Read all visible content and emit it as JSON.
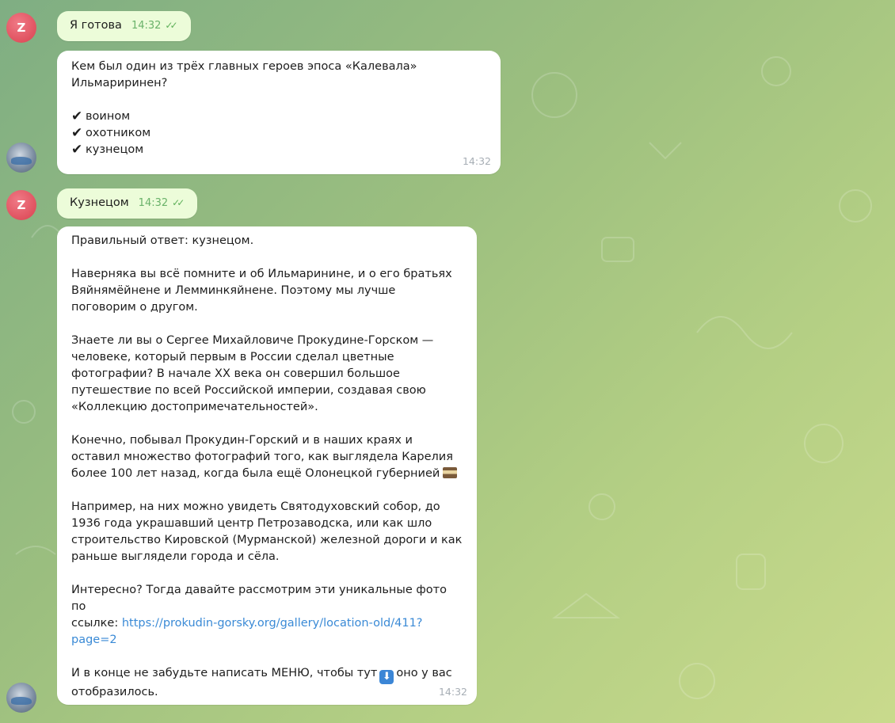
{
  "chat": {
    "user_avatar_initial": "Z",
    "messages": [
      {
        "text": "Я готова",
        "time": "14:32"
      },
      {
        "question": "Кем был один из трёх главных героев эпоса «Калевала»\nИльмариринен?",
        "options": [
          "воином",
          "охотником",
          "кузнецом"
        ],
        "time": "14:32"
      },
      {
        "text": "Кузнецом",
        "time": "14:32"
      },
      {
        "paragraphs": [
          "Правильный ответ: кузнецом.",
          "Наверняка вы всё помните и об Ильмаринине, и о его братьях\nВяйнямёйнене и Лемминкяйнене. Поэтому мы лучше\nпоговорим о другом.",
          "Знаете ли вы о Сергее Михайловиче Прокудине-Горском —\nчеловеке, который первым в России сделал цветные\nфотографии? В начале XX века он совершил большое\nпутешествие по всей Российской империи, создавая свою\n«Коллекцию достопримечательностей».",
          "Конечно, побывал Прокудин-Горский и в наших краях и\nоставил множество фотографий того, как выглядела Карелия\nболее 100 лет назад, когда была ещё Олонецкой губернией",
          "Например, на них можно увидеть Святодуховский собор, до\n1936 года украшавший центр Петрозаводска, или как шло\nстроительство Кировской (Мурманской) железной дороги и как\nраньше выглядели города и сёла.",
          "Интересно? Тогда давайте рассмотрим эти уникальные фото по\nссылке: ",
          "И в конце не забудьте написать МЕНЮ, чтобы тут",
          "оно у вас\nотобразилось."
        ],
        "link": "https://prokudin-gorsky.org/gallery/location-old/411?\npage=2",
        "time": "14:32"
      }
    ]
  },
  "colors": {
    "bg_start": "#7fae83",
    "bg_end": "#c9da8c",
    "outgoing_bubble": "#ecfcd9",
    "incoming_bubble": "#ffffff",
    "link": "#3a8ad6",
    "read_ticks": "#5fb05a",
    "user_avatar": "#d9414f"
  },
  "icons": {
    "check": "heavy-check-mark",
    "read_status": "double-check",
    "book_emoji": "books-emoji",
    "down_arrow_emoji": "down-arrow-emoji"
  }
}
